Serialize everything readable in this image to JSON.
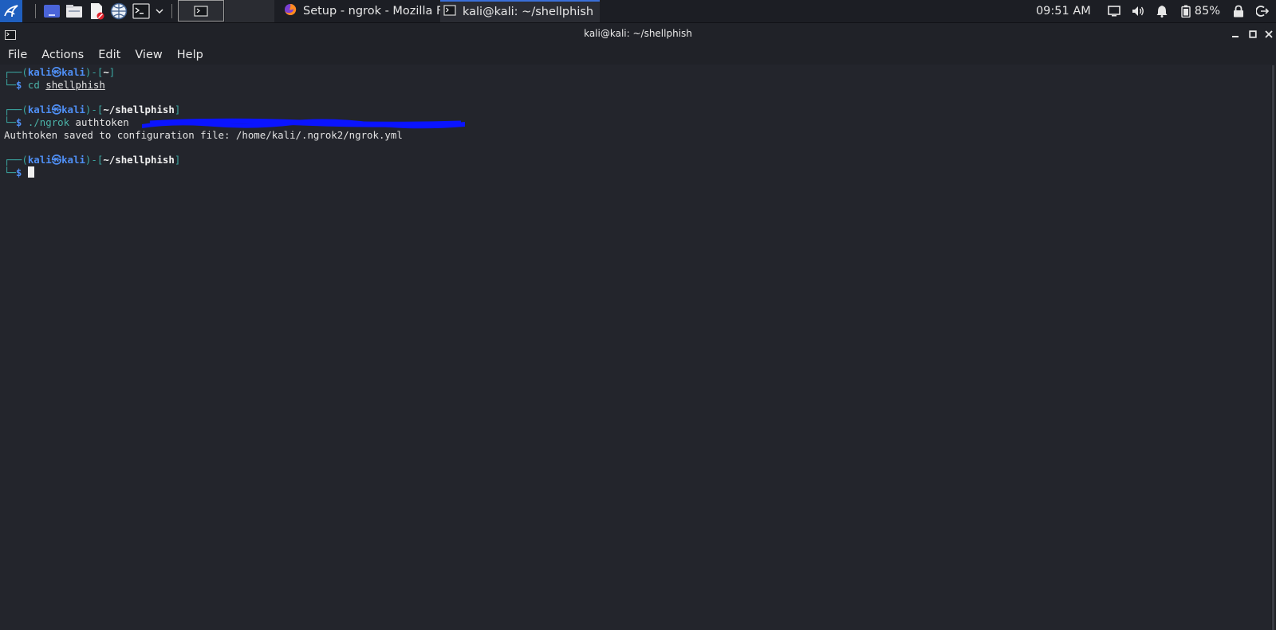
{
  "panel": {
    "taskbar_items": [
      {
        "label": "Setup - ngrok - Mozilla F..."
      },
      {
        "label": "kali@kali: ~/shellphish"
      }
    ],
    "clock": "09:51 AM",
    "battery": "85%"
  },
  "window": {
    "title": "kali@kali: ~/shellphish"
  },
  "menu": [
    "File",
    "Actions",
    "Edit",
    "View",
    "Help"
  ],
  "terminal": {
    "prompt1": {
      "user": "kali",
      "at": "㉿",
      "host": "kali",
      "dir": "~",
      "cmd": "cd",
      "arg": "shellphish"
    },
    "prompt2": {
      "user": "kali",
      "at": "㉿",
      "host": "kali",
      "dir": "~/shellphish",
      "cmd": "./ngrok",
      "arg": "authtoken"
    },
    "output": "Authtoken saved to configuration file: /home/kali/.ngrok2/ngrok.yml",
    "prompt3": {
      "user": "kali",
      "at": "㉿",
      "host": "kali",
      "dir": "~/shellphish"
    }
  },
  "colors": {
    "accent": "#3a6fd8",
    "prompt_teal": "#3ba7a2",
    "prompt_blue": "#4f8ff5",
    "redaction": "#0a14ff"
  }
}
